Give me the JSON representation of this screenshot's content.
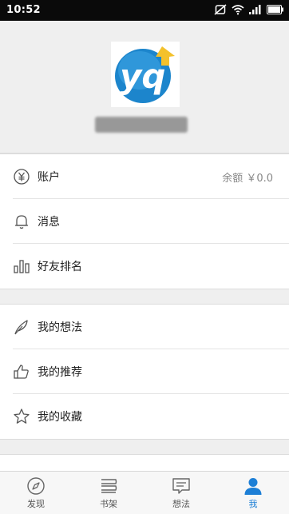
{
  "status_bar": {
    "time": "10:52"
  },
  "profile": {
    "logo_text": "yq"
  },
  "group1": [
    {
      "label": "账户",
      "right": "余额  ￥0.0",
      "icon": "yen-icon"
    },
    {
      "label": "消息",
      "icon": "bell-icon"
    },
    {
      "label": "好友排名",
      "icon": "bar-chart-icon"
    }
  ],
  "group2": [
    {
      "label": "我的想法",
      "icon": "feather-icon"
    },
    {
      "label": "我的推荐",
      "icon": "thumbs-up-icon"
    },
    {
      "label": "我的收藏",
      "icon": "star-icon"
    }
  ],
  "tabbar": [
    {
      "label": "发现",
      "icon": "compass-icon",
      "active": false
    },
    {
      "label": "书架",
      "icon": "bookshelf-icon",
      "active": false
    },
    {
      "label": "想法",
      "icon": "comment-icon",
      "active": false
    },
    {
      "label": "我",
      "icon": "user-icon",
      "active": true
    }
  ],
  "colors": {
    "accent": "#1d7fd6",
    "status_bar": "#0a0a0a",
    "background": "#efefef"
  }
}
